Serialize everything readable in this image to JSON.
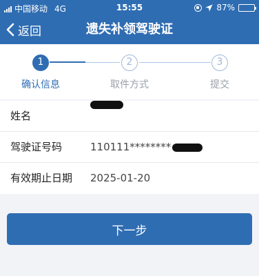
{
  "status_bar": {
    "carrier": "中国移动",
    "network": "4G",
    "time": "15:55",
    "battery_percent": "87%",
    "battery_level": 0.87,
    "battery_color": "#5fd35f"
  },
  "nav": {
    "back_label": "返回",
    "title": "遗失补领驾驶证"
  },
  "steps": [
    {
      "number": "1",
      "label": "确认信息",
      "active": true
    },
    {
      "number": "2",
      "label": "取件方式",
      "active": false
    },
    {
      "number": "3",
      "label": "提交",
      "active": false
    }
  ],
  "info": {
    "name_label": "姓名",
    "license_label": "驾驶证号码",
    "license_value": "110111********",
    "expiry_label": "有效期止日期",
    "expiry_value": "2025-01-20"
  },
  "next_button": "下一步",
  "colors": {
    "primary": "#2f6db3",
    "background": "#f2f3f7"
  }
}
